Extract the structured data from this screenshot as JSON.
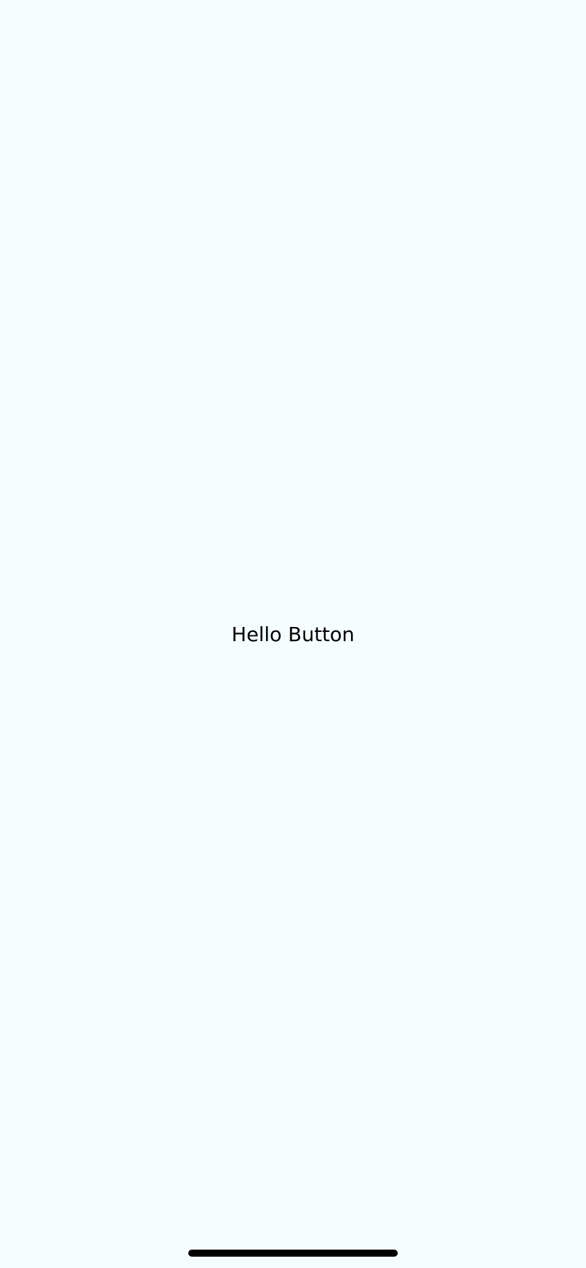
{
  "main": {
    "button_label": "Hello Button"
  },
  "colors": {
    "background": "#f5fdff",
    "text": "#000000",
    "home_indicator": "#000000"
  },
  "icons": {
    "home_indicator": "home-indicator-bar"
  }
}
